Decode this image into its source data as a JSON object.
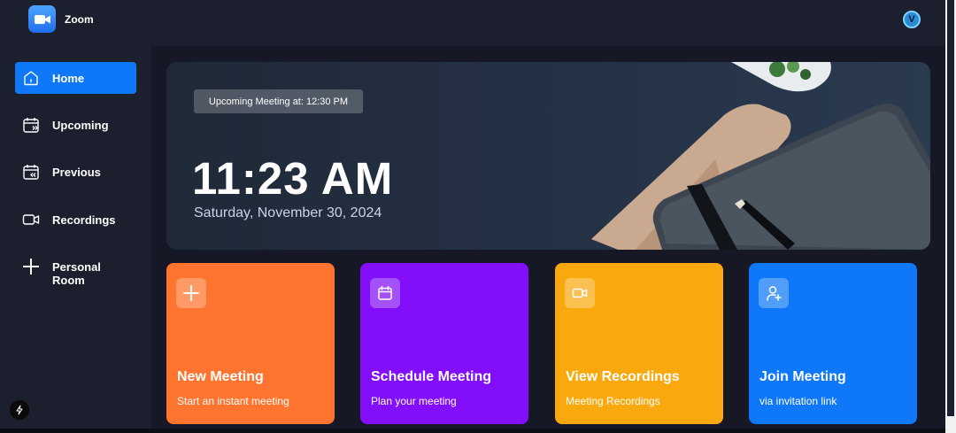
{
  "app": {
    "name": "Zoom",
    "avatar_initial": "V"
  },
  "sidebar": {
    "items": [
      {
        "label": "Home",
        "icon": "home-icon",
        "active": true
      },
      {
        "label": "Upcoming",
        "icon": "calendar-forward-icon",
        "active": false
      },
      {
        "label": "Previous",
        "icon": "calendar-back-icon",
        "active": false
      },
      {
        "label": "Recordings",
        "icon": "video-icon",
        "active": false
      },
      {
        "label": "Personal Room",
        "icon": "plus-icon",
        "active": false
      }
    ]
  },
  "hero": {
    "upcoming": "Upcoming Meeting at: 12:30 PM",
    "time": "11:23 AM",
    "date": "Saturday, November 30, 2024"
  },
  "cards": [
    {
      "title": "New Meeting",
      "subtitle": "Start an instant meeting",
      "icon": "plus-icon",
      "color": "#ff742e"
    },
    {
      "title": "Schedule Meeting",
      "subtitle": "Plan your meeting",
      "icon": "calendar-icon",
      "color": "#830ef9"
    },
    {
      "title": "View Recordings",
      "subtitle": "Meeting Recordings",
      "icon": "video-icon",
      "color": "#f9a90e"
    },
    {
      "title": "Join Meeting",
      "subtitle": "via invitation link",
      "icon": "add-user-icon",
      "color": "#0e78f9"
    }
  ],
  "colors": {
    "accent": "#0e78f9",
    "background": "#1c1f2e",
    "main_bg": "#161925"
  }
}
